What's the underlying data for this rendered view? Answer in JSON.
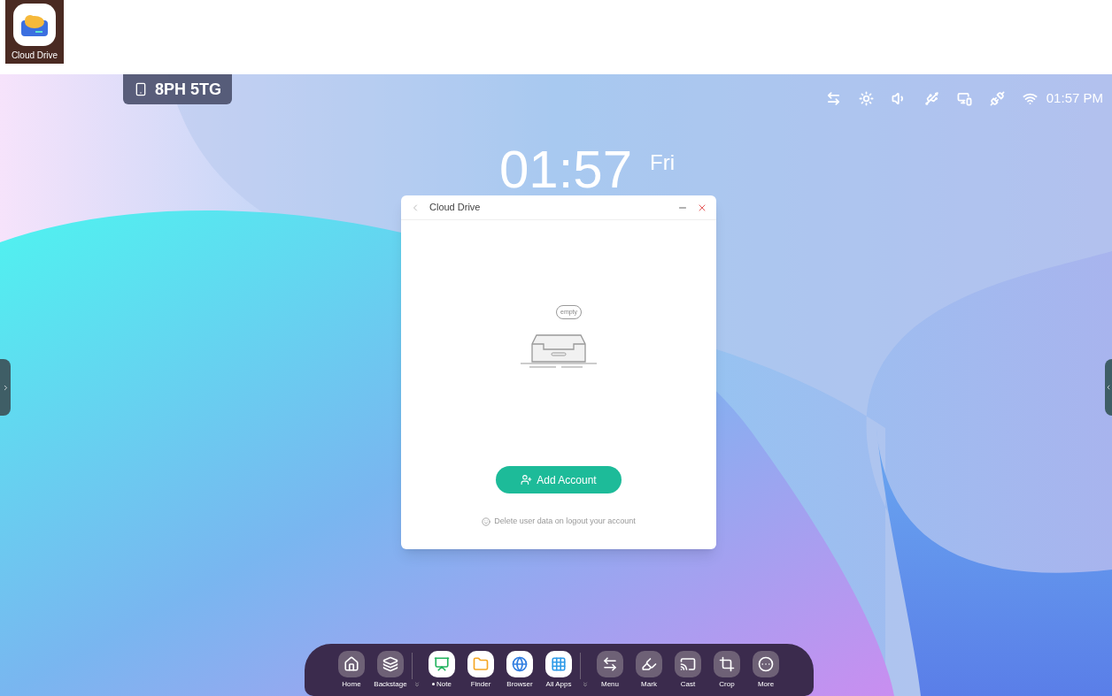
{
  "desktop_shortcut": {
    "label": "Cloud Drive"
  },
  "room_code": {
    "text": "8PH 5TG"
  },
  "status_bar": {
    "time": "01:57 PM"
  },
  "clock": {
    "time": "01:57",
    "day": "Fri"
  },
  "window": {
    "title": "Cloud Drive",
    "empty_label": "empty",
    "button": "Add Account",
    "note": "Delete user data on logout your account"
  },
  "dock": {
    "groups": [
      [
        {
          "label": "Home",
          "kind": "tool",
          "running": false
        },
        {
          "label": "Backstage",
          "kind": "tool",
          "running": false
        }
      ],
      [
        {
          "label": "Note",
          "kind": "app",
          "running": true
        },
        {
          "label": "Finder",
          "kind": "app",
          "running": false
        },
        {
          "label": "Browser",
          "kind": "app",
          "running": false
        },
        {
          "label": "All Apps",
          "kind": "app",
          "running": false
        }
      ],
      [
        {
          "label": "Menu",
          "kind": "tool",
          "running": false
        },
        {
          "label": "Mark",
          "kind": "tool",
          "running": false
        },
        {
          "label": "Cast",
          "kind": "tool",
          "running": false
        },
        {
          "label": "Crop",
          "kind": "tool",
          "running": false
        },
        {
          "label": "More",
          "kind": "tool",
          "running": false
        }
      ]
    ]
  }
}
